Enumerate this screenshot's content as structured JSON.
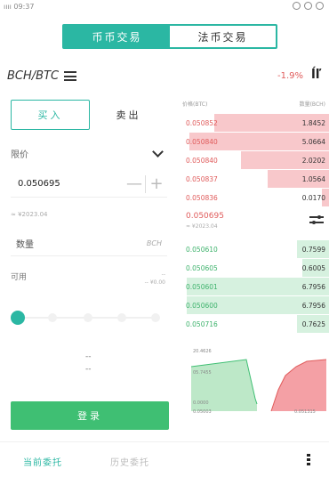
{
  "status": {
    "time": "ıııı 09:37"
  },
  "top_tabs": [
    {
      "label": "币币交易"
    },
    {
      "label": "法币交易"
    }
  ],
  "pair": {
    "symbol": "BCH/BTC",
    "change": "-1.9%"
  },
  "trade": {
    "buy_label": "买入",
    "sell_label": "卖出",
    "order_type": "限价",
    "price_value": "0.050695",
    "price_approx": "≈ ¥2023.04",
    "amount_placeholder": "数量",
    "amount_unit": "BCH",
    "available_label": "可用",
    "available_value_top": "--",
    "available_value_bottom": "-- ¥0.00",
    "slider_percent": 0,
    "mid_dash_1": "--",
    "mid_dash_2": "--",
    "submit_label": "登录"
  },
  "orderbook": {
    "price_header": "价格(BTC)",
    "amount_header": "数量(BCH)",
    "asks": [
      {
        "price": "0.050852",
        "amount": "1.8452",
        "depth": 0.78
      },
      {
        "price": "0.050840",
        "amount": "5.0664",
        "depth": 0.95
      },
      {
        "price": "0.050840",
        "amount": "2.0202",
        "depth": 0.6
      },
      {
        "price": "0.050837",
        "amount": "1.0564",
        "depth": 0.42
      },
      {
        "price": "0.050836",
        "amount": "0.0170",
        "depth": 0.05
      }
    ],
    "mid_price": "0.050695",
    "mid_cny": "≈ ¥2023.04",
    "bids": [
      {
        "price": "0.050610",
        "amount": "0.7599",
        "depth": 0.22
      },
      {
        "price": "0.050605",
        "amount": "0.6005",
        "depth": 0.18
      },
      {
        "price": "0.050601",
        "amount": "6.7956",
        "depth": 0.97
      },
      {
        "price": "0.050600",
        "amount": "6.7956",
        "depth": 0.97
      },
      {
        "price": "0.050716",
        "amount": "0.7625",
        "depth": 0.22
      }
    ]
  },
  "depth_chart": {
    "y_top": "20.4626",
    "y_mid": "05.7455",
    "y_bottom": "0.0000",
    "x_left": "0.05003",
    "x_right": "0.051315"
  },
  "bottom_tabs": [
    {
      "label": "当前委托"
    },
    {
      "label": "历史委托"
    }
  ],
  "colors": {
    "accent": "#2bb7a3",
    "buy": "#3fbf73",
    "sell": "#e05b5b"
  }
}
